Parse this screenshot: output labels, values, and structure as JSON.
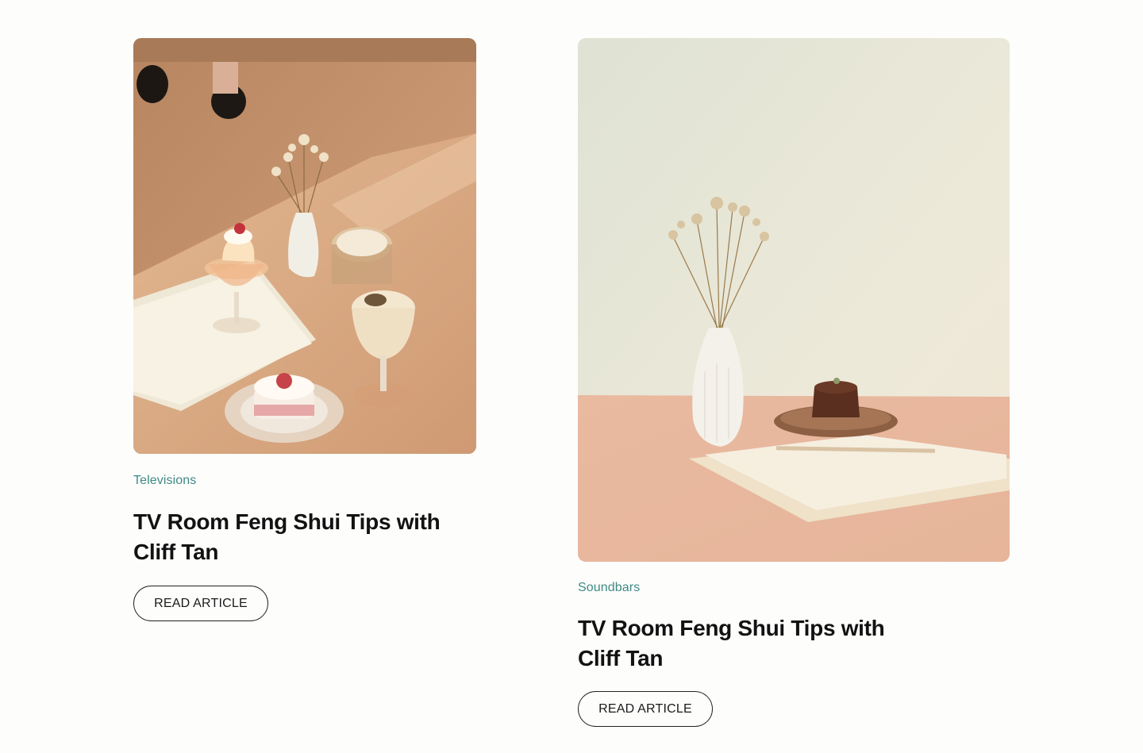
{
  "articles": [
    {
      "image_alt": "Desserts, coffee and a vase of dried flowers on a wooden table",
      "category": "Televisions",
      "title": "TV Room Feng Shui Tips with Cliff Tan",
      "button_label": "READ ARTICLE"
    },
    {
      "image_alt": "White vase of dried flowers beside a small cake on a plate",
      "category": "Soundbars",
      "title": "TV Room Feng Shui Tips with Cliff Tan",
      "button_label": "READ ARTICLE"
    }
  ],
  "colors": {
    "category": "#3f8a84",
    "title": "#121212",
    "button_border": "#222222",
    "background": "#fdfdfc"
  }
}
